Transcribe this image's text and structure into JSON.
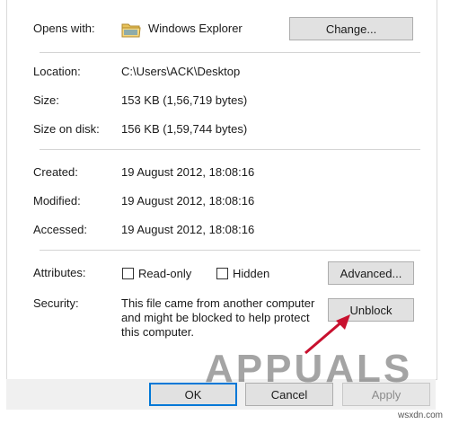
{
  "general": {
    "opens_with": {
      "label": "Opens with:",
      "app": "Windows Explorer",
      "change_button": "Change..."
    },
    "location": {
      "label": "Location:",
      "value": "C:\\Users\\ACK\\Desktop"
    },
    "size": {
      "label": "Size:",
      "value": "153 KB (1,56,719 bytes)"
    },
    "size_on_disk": {
      "label": "Size on disk:",
      "value": "156 KB (1,59,744 bytes)"
    },
    "created": {
      "label": "Created:",
      "value": "19 August 2012, 18:08:16"
    },
    "modified": {
      "label": "Modified:",
      "value": "19 August 2012, 18:08:16"
    },
    "accessed": {
      "label": "Accessed:",
      "value": "19 August 2012, 18:08:16"
    },
    "attributes": {
      "label": "Attributes:",
      "readonly_label": "Read-only",
      "readonly_checked": false,
      "hidden_label": "Hidden",
      "hidden_checked": false,
      "advanced_button": "Advanced..."
    },
    "security": {
      "label": "Security:",
      "message_lines": [
        "This file came from another computer",
        "and might be blocked to help protect",
        "this computer."
      ],
      "unblock_button": "Unblock"
    }
  },
  "footer": {
    "ok": "OK",
    "cancel": "Cancel",
    "apply": "Apply"
  },
  "watermark": {
    "text": "APPUALS",
    "source": "wsxdn.com"
  },
  "colors": {
    "arrow": "#c8102e",
    "folder": "#e8c25a",
    "accent": "#0078d7"
  },
  "icons": {
    "opens_with_app": "folder-icon",
    "annotation": "red-arrow-icon"
  }
}
